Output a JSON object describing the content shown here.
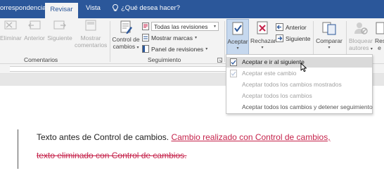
{
  "tabs": {
    "correspondencia": "orrespondencia",
    "revisar": "Revisar",
    "vista": "Vista",
    "tell_me": "¿Qué desea hacer?"
  },
  "ribbon": {
    "comentarios": {
      "eliminar": "Eliminar",
      "anterior": "Anterior",
      "siguiente": "Siguiente",
      "mostrar_l1": "Mostrar",
      "mostrar_l2": "comentarios",
      "group_label": "Comentarios"
    },
    "seguimiento": {
      "control_l1": "Control de",
      "control_l2": "cambios",
      "todas_revisiones": "Todas las revisiones",
      "mostrar_marcas": "Mostrar marcas",
      "panel_revisiones": "Panel de revisiones",
      "group_label": "Seguimiento"
    },
    "cambios": {
      "aceptar": "Aceptar",
      "rechazar": "Rechazar",
      "anterior": "Anterior",
      "siguiente": "Siguiente"
    },
    "comparar": {
      "label": "Comparar"
    },
    "proteger": {
      "bloquear_l1": "Bloquear",
      "bloquear_l2": "autores",
      "res_l1": "Res",
      "res_l2": "e"
    }
  },
  "menu": {
    "items": [
      "Aceptar e ir al siguiente",
      "Aceptar este cambio",
      "Aceptar todos los cambios mostrados",
      "Aceptar todos los cambios",
      "Aceptar todos los cambios y detener seguimiento"
    ]
  },
  "document": {
    "line1_plain": "Texto antes de Control de cambios. ",
    "line1_inserted": "Cambio realizado con Control de cambios,",
    "line2_deleted": "texto eliminado con Control de cambios."
  },
  "colors": {
    "title_bar": "#2b579a",
    "revision": "#c5234b",
    "ribbon_bg": "#f3f3f3"
  }
}
